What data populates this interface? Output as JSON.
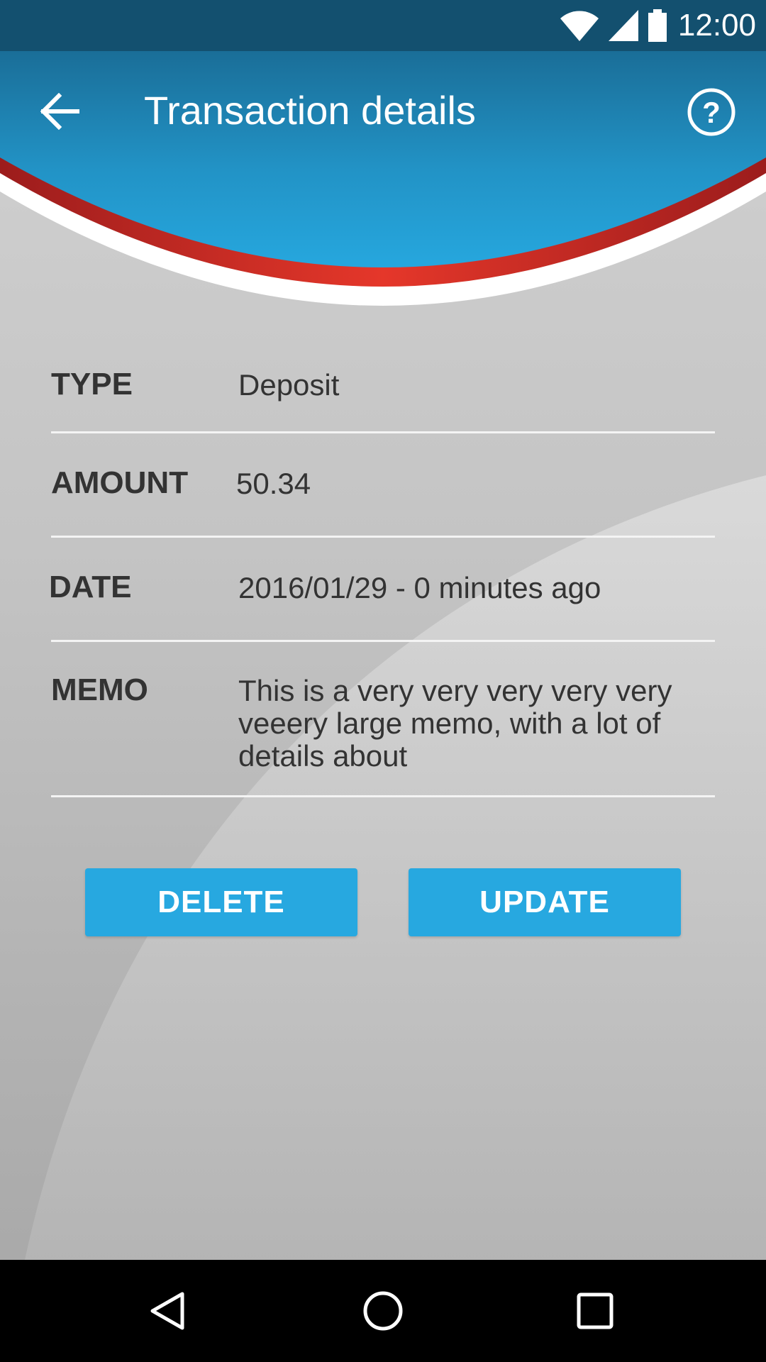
{
  "status_bar": {
    "time": "12:00",
    "icons": [
      "wifi-icon",
      "cell-signal-icon",
      "battery-icon"
    ]
  },
  "header": {
    "title": "Transaction details",
    "back_icon": "arrow-left-icon",
    "help_icon": "help-circle-icon"
  },
  "details": [
    {
      "label": "TYPE",
      "value": "Deposit"
    },
    {
      "label": "AMOUNT",
      "value": "50.34"
    },
    {
      "label": "DATE",
      "value": "2016/01/29 - 0 minutes ago"
    },
    {
      "label": "MEMO",
      "value": "This is a very very very very very veeery large memo, with a lot of details about"
    }
  ],
  "actions": {
    "delete_label": "DELETE",
    "update_label": "UPDATE"
  },
  "nav": {
    "icons": [
      "nav-back-icon",
      "nav-home-icon",
      "nav-recents-icon"
    ]
  },
  "colors": {
    "status_bar": "#13506f",
    "header_top": "#1a6e98",
    "header_bottom": "#26a5dc",
    "red_stripe": "#d22a20",
    "button": "#27a8e0",
    "text": "#333333"
  }
}
